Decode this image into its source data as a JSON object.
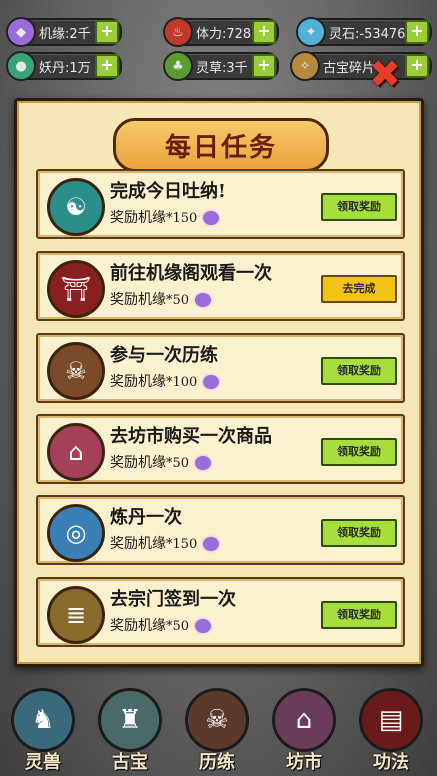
{
  "resources": [
    {
      "label": "机缘:2千",
      "icon": "gem-icon",
      "color": "#9b6bd9"
    },
    {
      "label": "体力:728",
      "icon": "potion-icon",
      "color": "#c0392b"
    },
    {
      "label": "灵石:-53476",
      "icon": "crystal-icon",
      "color": "#4fb3d9"
    },
    {
      "label": "妖丹:1万",
      "icon": "orb-icon",
      "color": "#3aa373"
    },
    {
      "label": "灵草:3千",
      "icon": "herb-icon",
      "color": "#5b9c2e"
    },
    {
      "label": "古宝碎片",
      "icon": "relic-icon",
      "color": "#b58a3a"
    }
  ],
  "panel": {
    "title": "每日任务"
  },
  "tasks": [
    {
      "name": "完成今日吐纳!",
      "reward_label": "奖励机缘",
      "amount": "*150",
      "button": "领取奖励",
      "state": "green",
      "icon": "meditation-icon",
      "color": "#2a8f8a"
    },
    {
      "name": "前往机缘阁观看一次",
      "reward_label": "奖励机缘",
      "amount": "*50",
      "button": "去完成",
      "state": "yellow",
      "icon": "pavilion-icon",
      "color": "#8a1f1f"
    },
    {
      "name": "参与一次历练",
      "reward_label": "奖励机缘",
      "amount": "*100",
      "button": "领取奖励",
      "state": "green",
      "icon": "skull-icon",
      "color": "#7a4a2a"
    },
    {
      "name": "去坊市购买一次商品",
      "reward_label": "奖励机缘",
      "amount": "*50",
      "button": "领取奖励",
      "state": "green",
      "icon": "shop-icon",
      "color": "#a5405a"
    },
    {
      "name": "炼丹一次",
      "reward_label": "奖励机缘",
      "amount": "*150",
      "button": "领取奖励",
      "state": "green",
      "icon": "crystal-ball-icon",
      "color": "#3a7fb5"
    },
    {
      "name": "去宗门签到一次",
      "reward_label": "奖励机缘",
      "amount": "*50",
      "button": "领取奖励",
      "state": "green",
      "icon": "scroll-icon",
      "color": "#8a6a2a"
    }
  ],
  "nav": [
    {
      "label": "灵兽",
      "icon": "beast-icon",
      "color": "#3a6a7a"
    },
    {
      "label": "古宝",
      "icon": "treasure-icon",
      "color": "#4a6a6a"
    },
    {
      "label": "历练",
      "icon": "skull-icon",
      "color": "#5a3a2a"
    },
    {
      "label": "坊市",
      "icon": "shop-icon",
      "color": "#6a3a5a"
    },
    {
      "label": "功法",
      "icon": "book-icon",
      "color": "#6a1a1a"
    }
  ]
}
